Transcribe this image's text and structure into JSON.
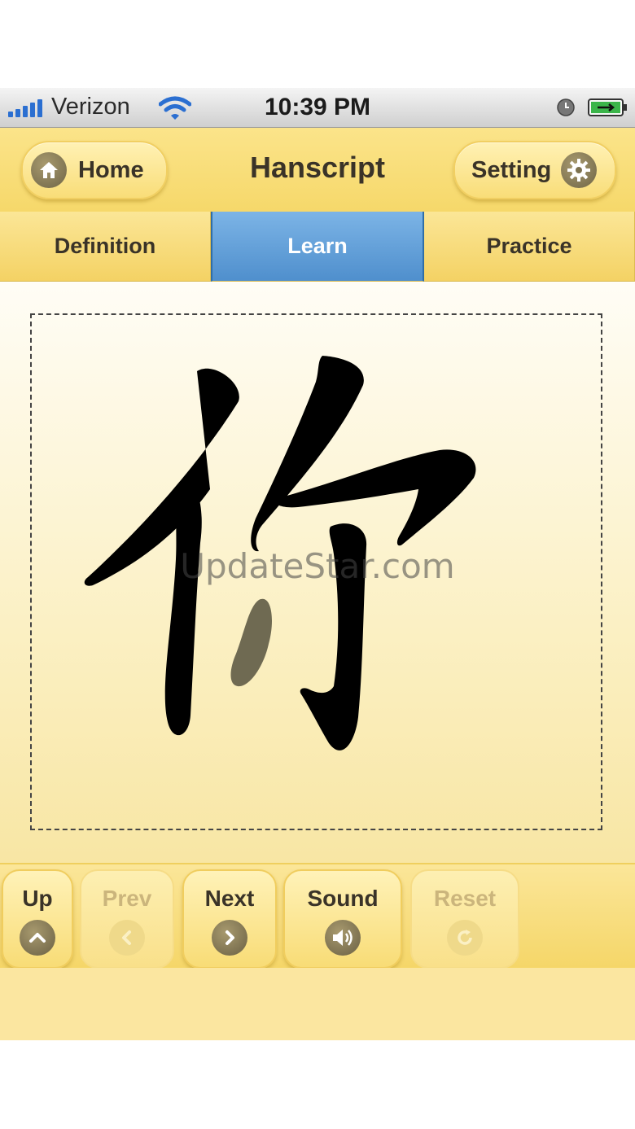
{
  "status_bar": {
    "carrier": "Verizon",
    "time": "10:39 PM"
  },
  "navbar": {
    "home_label": "Home",
    "title": "Hanscript",
    "setting_label": "Setting"
  },
  "tabs": [
    {
      "label": "Definition",
      "active": false
    },
    {
      "label": "Learn",
      "active": true
    },
    {
      "label": "Practice",
      "active": false
    }
  ],
  "content": {
    "character": "你",
    "watermark": "UpdateStar.com"
  },
  "toolbar": {
    "up": "Up",
    "prev": "Prev",
    "next": "Next",
    "sound": "Sound",
    "reset": "Reset"
  },
  "colors": {
    "accent_blue": "#5b9ad6",
    "yellow": "#f6d86a",
    "icon_disc": "#7c714f"
  }
}
